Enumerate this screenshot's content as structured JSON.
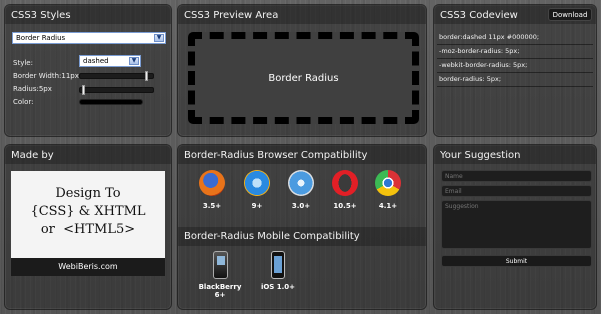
{
  "styles_panel": {
    "title": "CSS3 Styles",
    "property_select": "Border Radius",
    "style_label": "Style:",
    "style_value": "dashed",
    "border_width_label": "Border Width:11px",
    "border_width_level": 0.9,
    "radius_label": "Radius:5px",
    "radius_level": 0.03,
    "color_label": "Color:",
    "color_value": "#000000"
  },
  "preview_panel": {
    "title": "CSS3 Preview Area",
    "preview_text": "Border Radius"
  },
  "codeview_panel": {
    "title": "CSS3 Codeview",
    "download_label": "Download",
    "lines": [
      "border:dashed 11px #000000;",
      "-moz-border-radius: 5px;",
      "-webkit-border-radius: 5px;",
      "border-radius: 5px;"
    ]
  },
  "madeby_panel": {
    "title": "Made by",
    "banner_line1": "Design To",
    "banner_line2": "{CSS} & XHTML",
    "banner_line3": "or  <HTML5>",
    "site_name": "WebiBeris.com"
  },
  "browser_compat": {
    "title": "Border-Radius Browser Compatibility",
    "browsers": [
      {
        "icon": "firefox-icon",
        "version": "3.5+"
      },
      {
        "icon": "ie-icon",
        "version": "9+"
      },
      {
        "icon": "safari-icon",
        "version": "3.0+"
      },
      {
        "icon": "opera-icon",
        "version": "10.5+"
      },
      {
        "icon": "chrome-icon",
        "version": "4.1+"
      }
    ]
  },
  "mobile_compat": {
    "title": "Border-Radius Mobile Compatibility",
    "devices": [
      {
        "icon": "blackberry-icon",
        "label": "BlackBerry 6+"
      },
      {
        "icon": "iphone-icon",
        "label": "iOS 1.0+"
      }
    ]
  },
  "suggestion_panel": {
    "title": "Your Suggestion",
    "name_placeholder": "Name",
    "email_placeholder": "Email",
    "suggestion_placeholder": "Suggestion",
    "submit_label": "Submit"
  },
  "colors": {
    "accent_border": "#000000",
    "panel_bg": "#2a2a2a"
  }
}
